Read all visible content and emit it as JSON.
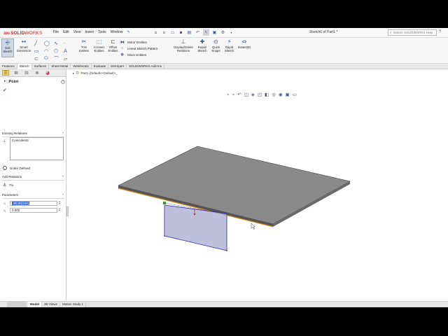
{
  "app": {
    "logo_symbol": "3DS",
    "logo_bold": "SOLID",
    "logo_rest": "WORKS",
    "menu": [
      "File",
      "Edit",
      "View",
      "Insert",
      "Tools",
      "Window"
    ],
    "doc_title": "Sketch6 of Part1 *",
    "search_placeholder": "Search SOLIDWORKS Help",
    "help_icon": "help-icon"
  },
  "toolbar_icons": [
    "home-icon",
    "new-icon",
    "open-icon",
    "save-icon",
    "print-icon",
    "undo-icon",
    "select-icon",
    "rebuild-icon",
    "options-icon"
  ],
  "command_manager": {
    "exit_sketch": "Exit Sketch",
    "smart_dimension": "Smart Dimension",
    "trim_entities": "Trim Entities",
    "convert_entities": "Convert Entities",
    "offset_entities": "Offset Entities",
    "mirror_entities": "Mirror Entities",
    "linear_sketch_pattern": "Linear Sketch Pattern",
    "move_entities": "Move Entities",
    "display_delete_relations": "Display/Delete Relations",
    "repair_sketch": "Repair Sketch",
    "quick_snaps": "Quick Snaps",
    "rapid_sketch": "Rapid Sketch",
    "instant2d": "Instant2D"
  },
  "tabs": [
    {
      "label": "Features",
      "active": false
    },
    {
      "label": "Sketch",
      "active": true
    },
    {
      "label": "Surfaces",
      "active": false
    },
    {
      "label": "Sheet Metal",
      "active": false
    },
    {
      "label": "Weldments",
      "active": false
    },
    {
      "label": "Evaluate",
      "active": false
    },
    {
      "label": "DimXpert",
      "active": false
    },
    {
      "label": "SOLIDWORKS Add-Ins",
      "active": false
    }
  ],
  "property_manager": {
    "title": "Point",
    "existing_relations_header": "Existing Relations",
    "relations": [
      "Coincident4"
    ],
    "status": "Under Defined",
    "add_relations_header": "Add Relations",
    "add_relation_option": "Fix",
    "parameters_header": "Parameters",
    "x_value": "-60.00(100)",
    "y_value": "0.000"
  },
  "viewport": {
    "tree_root": "Part1  (Default<<Default>_"
  },
  "bottom_tabs": [
    {
      "label": "Model",
      "active": true
    },
    {
      "label": "3D Views",
      "active": false
    },
    {
      "label": "Motion Study 1",
      "active": false
    }
  ],
  "colors": {
    "plate_top": "#8a8a8a",
    "plate_front": "#555555",
    "plate_edge_highlight": "#e08a20",
    "sketch_plane": "#a8a8d2",
    "sketch_line": "#2c2cb8",
    "accent_red": "#d02020"
  }
}
